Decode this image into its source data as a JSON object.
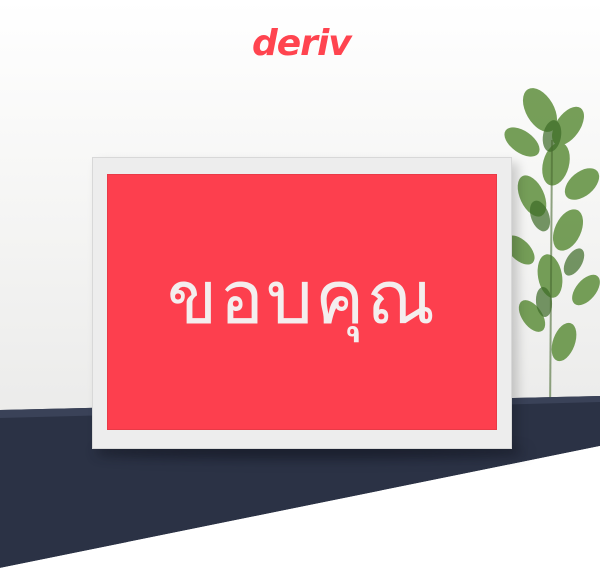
{
  "brand": {
    "logo_text": "deriv",
    "color": "#ff444f"
  },
  "sign": {
    "text": "ขอบคุณ",
    "background_color": "#fd3f4e",
    "frame_color": "#ededed",
    "text_color": "#f4eeee"
  },
  "scene": {
    "wall_color": "#f4f4f3",
    "desk_color": "#2b3245",
    "decor": "potted-plant"
  }
}
